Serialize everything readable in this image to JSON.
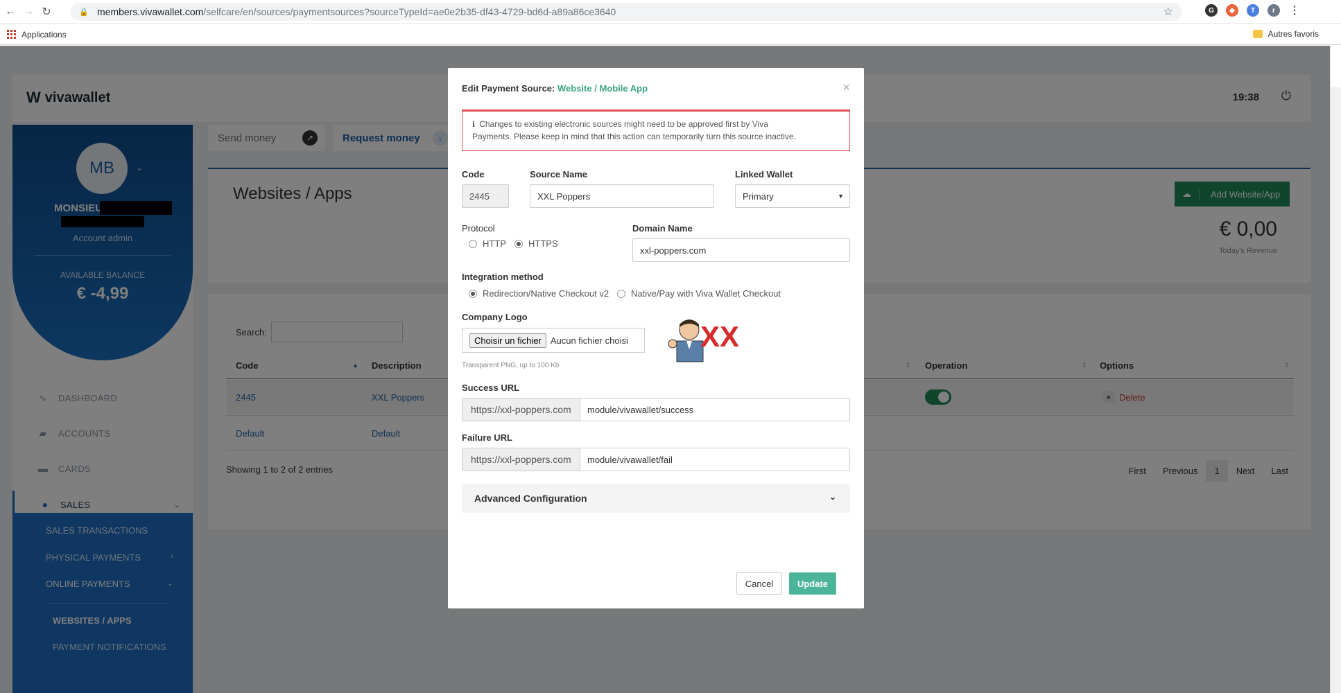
{
  "browser": {
    "url_host": "members.vivawallet.com",
    "url_path": "/selfcare/en/sources/paymentsources?sourceTypeId=ae0e2b35-df43-4729-bd6d-a89a86ce3640",
    "bookmarks_apps": "Applications",
    "bookmarks_other": "Autres favoris",
    "profile_initial": "r"
  },
  "header": {
    "logo_text": "vivawallet",
    "time": "19:38"
  },
  "sidebar": {
    "avatar_initials": "MB",
    "user_name": "MONSIEUR",
    "role": "Account admin",
    "balance_label": "AVAILABLE BALANCE",
    "balance_value": "€ -4,99",
    "nav": [
      {
        "label": "DASHBOARD",
        "icon": "pulse-icon"
      },
      {
        "label": "ACCOUNTS",
        "icon": "wallet-icon"
      },
      {
        "label": "CARDS",
        "icon": "card-icon"
      },
      {
        "label": "SALES",
        "icon": "sales-icon"
      }
    ],
    "sub_nav": [
      {
        "label": "SALES TRANSACTIONS"
      },
      {
        "label": "PHYSICAL PAYMENTS"
      },
      {
        "label": "ONLINE PAYMENTS"
      },
      {
        "label": "WEBSITES / APPS"
      },
      {
        "label": "PAYMENT NOTIFICATIONS"
      }
    ]
  },
  "actions": {
    "send_money": "Send money",
    "request_money": "Request money"
  },
  "content": {
    "title": "Websites / Apps",
    "add_button": "Add Website/App",
    "revenue": "€ 0,00",
    "revenue_label": "Today's Revenue",
    "search_label": "Search:",
    "columns": [
      "Code",
      "Description",
      "Operation",
      "Options"
    ],
    "rows": [
      {
        "code": "2445",
        "description": "XXL Poppers",
        "delete": "Delete"
      },
      {
        "code": "Default",
        "description": "Default"
      }
    ],
    "showing": "Showing 1 to 2 of 2 entries",
    "pagination": {
      "first": "First",
      "previous": "Previous",
      "current": "1",
      "next": "Next",
      "last": "Last"
    }
  },
  "modal": {
    "title_prefix": "Edit Payment Source:",
    "title_accent": "Website / Mobile App",
    "alert_line1": "Changes to existing electronic sources might need to be approved first by Viva",
    "alert_line2": "Payments. Please keep in mind that this action can temporarily turn this source inactive.",
    "code_label": "Code",
    "code_value": "2445",
    "source_name_label": "Source Name",
    "source_name_value": "XXL Poppers",
    "wallet_label": "Linked Wallet",
    "wallet_value": "Primary",
    "protocol_label": "Protocol",
    "protocol_http": "HTTP",
    "protocol_https": "HTTPS",
    "protocol_selected": "HTTPS",
    "domain_label": "Domain Name",
    "domain_value": "xxl-poppers.com",
    "integration_label": "Integration method",
    "integration_opt1": "Redirection/Native Checkout v2",
    "integration_opt2": "Native/Pay with Viva Wallet Checkout",
    "logo_label": "Company Logo",
    "file_button": "Choisir un fichier",
    "file_status": "Aucun fichier choisi",
    "logo_text": "XXL",
    "logo_hint": "Transparent PNG, up to 100 Kb",
    "success_label": "Success URL",
    "success_prefix": "https://xxl-poppers.com",
    "success_suffix": "module/vivawallet/success",
    "failure_label": "Failure URL",
    "failure_prefix": "https://xxl-poppers.com",
    "failure_suffix": "module/vivawallet/fail",
    "advanced": "Advanced Configuration",
    "cancel": "Cancel",
    "update": "Update"
  },
  "colors": {
    "accent_green": "#3aa487",
    "brand_blue": "#1a6fc0",
    "alert_red": "#e15151"
  }
}
